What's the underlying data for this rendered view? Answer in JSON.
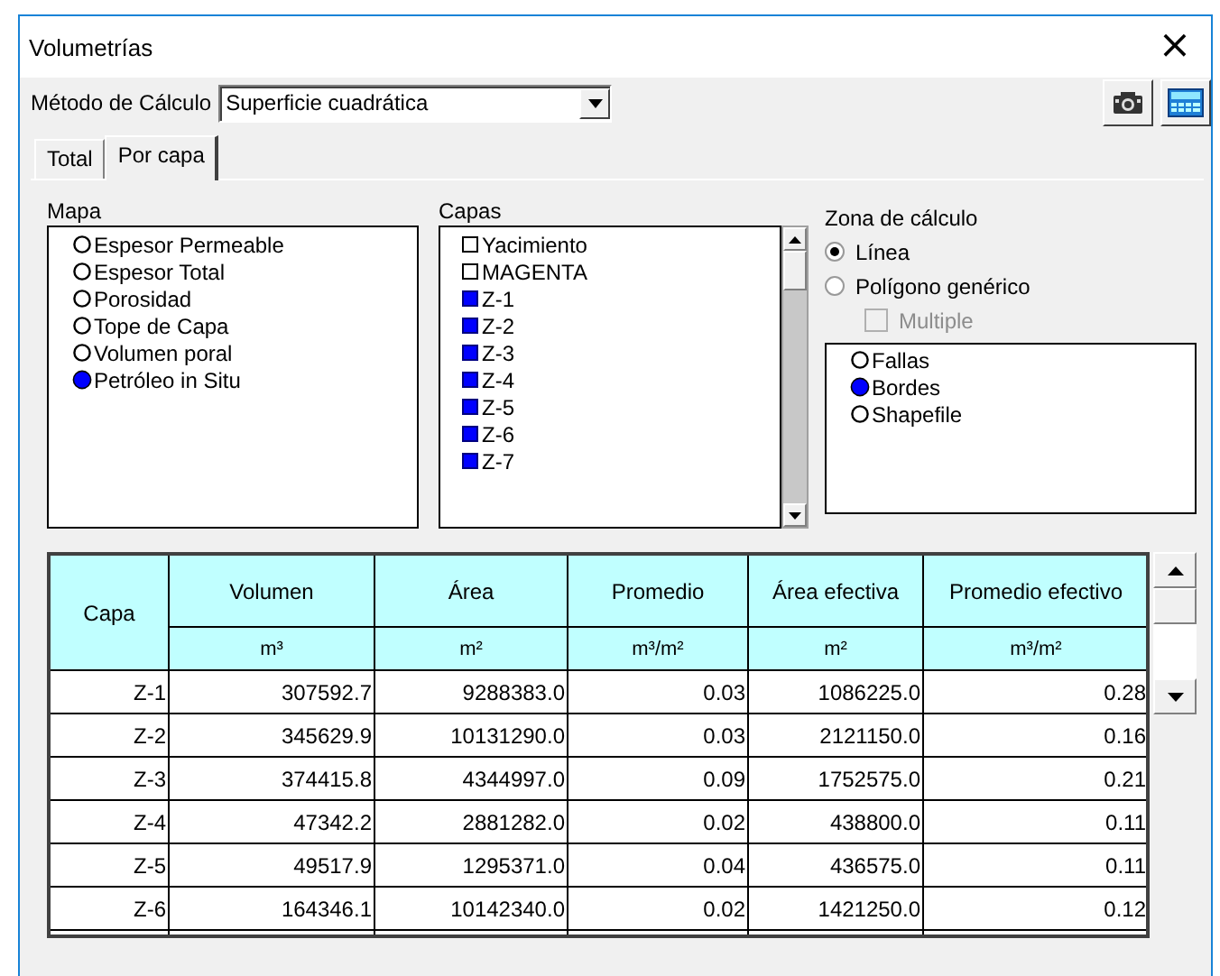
{
  "window": {
    "title": "Volumetrías",
    "close": "×"
  },
  "method": {
    "label": "Método de Cálculo",
    "value": "Superficie cuadrática"
  },
  "tabs": [
    {
      "label": "Total",
      "selected": false
    },
    {
      "label": "Por capa",
      "selected": true
    }
  ],
  "mapa": {
    "label": "Mapa",
    "items": [
      {
        "label": "Espesor Permeable",
        "selected": false
      },
      {
        "label": "Espesor Total",
        "selected": false
      },
      {
        "label": "Porosidad",
        "selected": false
      },
      {
        "label": "Tope de Capa",
        "selected": false
      },
      {
        "label": "Volumen poral",
        "selected": false
      },
      {
        "label": "Petróleo in Situ",
        "selected": true
      }
    ]
  },
  "capas": {
    "label": "Capas",
    "items": [
      {
        "label": "Yacimiento",
        "checked": false
      },
      {
        "label": "MAGENTA",
        "checked": false
      },
      {
        "label": "Z-1",
        "checked": true
      },
      {
        "label": "Z-2",
        "checked": true
      },
      {
        "label": "Z-3",
        "checked": true
      },
      {
        "label": "Z-4",
        "checked": true
      },
      {
        "label": "Z-5",
        "checked": true
      },
      {
        "label": "Z-6",
        "checked": true
      },
      {
        "label": "Z-7",
        "checked": true
      }
    ]
  },
  "zona": {
    "label": "Zona de cálculo",
    "options": [
      {
        "label": "Línea",
        "selected": true
      },
      {
        "label": "Polígono genérico",
        "selected": false
      }
    ],
    "multiple": {
      "label": "Multiple",
      "checked": false,
      "disabled": true
    },
    "items": [
      {
        "label": "Fallas",
        "selected": false
      },
      {
        "label": "Bordes",
        "selected": true
      },
      {
        "label": "Shapefile",
        "selected": false
      }
    ]
  },
  "table": {
    "columns": [
      {
        "label": "Capa"
      },
      {
        "label": "Volumen",
        "unit": "m³"
      },
      {
        "label": "Área",
        "unit": "m²"
      },
      {
        "label": "Promedio",
        "unit": "m³/m²"
      },
      {
        "label": "Área efectiva",
        "unit": "m²"
      },
      {
        "label": "Promedio efectivo",
        "unit": "m³/m²"
      }
    ],
    "rows": [
      [
        "Z-1",
        "307592.7",
        "9288383.0",
        "0.03",
        "1086225.0",
        "0.28"
      ],
      [
        "Z-2",
        "345629.9",
        "10131290.0",
        "0.03",
        "2121150.0",
        "0.16"
      ],
      [
        "Z-3",
        "374415.8",
        "4344997.0",
        "0.09",
        "1752575.0",
        "0.21"
      ],
      [
        "Z-4",
        "47342.2",
        "2881282.0",
        "0.02",
        "438800.0",
        "0.11"
      ],
      [
        "Z-5",
        "49517.9",
        "1295371.0",
        "0.04",
        "436575.0",
        "0.11"
      ],
      [
        "Z-6",
        "164346.1",
        "10142340.0",
        "0.02",
        "1421250.0",
        "0.12"
      ]
    ]
  }
}
